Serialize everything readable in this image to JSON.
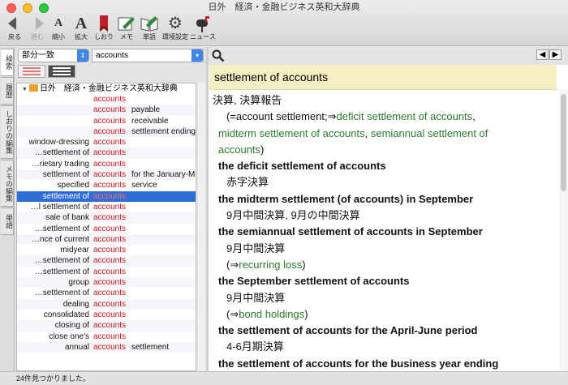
{
  "window": {
    "title": "日外　経済・金融ビジネス英和大辞典",
    "lights": [
      "#ff5f57",
      "#febc2e",
      "#28c840"
    ]
  },
  "toolbar": {
    "back": "戻る",
    "forward": "進む",
    "shrink": "縮小",
    "enlarge": "拡大",
    "bookmark": "しおり",
    "memo": "メモ",
    "wordbook": "単語",
    "settings": "環境設定",
    "news": "ニュース"
  },
  "tabs": {
    "search": "検索",
    "history": "履歴",
    "bookmark_edit": "しおりの編集",
    "memo_edit": "メモの編集",
    "wordbook": "単語"
  },
  "search": {
    "mode": "部分一致",
    "query": "accounts"
  },
  "list": {
    "dictionary": "日外　経済・金融ビジネス英和大辞典",
    "rows": [
      {
        "pre": "",
        "kw": "accounts",
        "post": ""
      },
      {
        "pre": "",
        "kw": "accounts",
        "post": "payable"
      },
      {
        "pre": "",
        "kw": "accounts",
        "post": "receivable"
      },
      {
        "pre": "",
        "kw": "accounts",
        "post": "settlement ending…"
      },
      {
        "pre": "window-dressing",
        "kw": "accounts",
        "post": ""
      },
      {
        "pre": "…settlement of",
        "kw": "accounts",
        "post": ""
      },
      {
        "pre": "…rietary trading",
        "kw": "accounts",
        "post": ""
      },
      {
        "pre": "settlement of",
        "kw": "accounts",
        "post": "for the January-M…"
      },
      {
        "pre": "specified",
        "kw": "accounts",
        "post": "service"
      },
      {
        "pre": "settlement of",
        "kw": "accounts",
        "post": "",
        "selected": true
      },
      {
        "pre": "…l settlement of",
        "kw": "accounts",
        "post": ""
      },
      {
        "pre": "sale of bank",
        "kw": "accounts",
        "post": ""
      },
      {
        "pre": "…settlement of",
        "kw": "accounts",
        "post": ""
      },
      {
        "pre": "…nce of current",
        "kw": "accounts",
        "post": ""
      },
      {
        "pre": "midyear",
        "kw": "accounts",
        "post": ""
      },
      {
        "pre": "…settlement of",
        "kw": "accounts",
        "post": ""
      },
      {
        "pre": "…settlement of",
        "kw": "accounts",
        "post": ""
      },
      {
        "pre": "group",
        "kw": "accounts",
        "post": ""
      },
      {
        "pre": "…settlement of",
        "kw": "accounts",
        "post": ""
      },
      {
        "pre": "dealing",
        "kw": "accounts",
        "post": ""
      },
      {
        "pre": "consolidated",
        "kw": "accounts",
        "post": ""
      },
      {
        "pre": "closing of",
        "kw": "accounts",
        "post": ""
      },
      {
        "pre": "close one's",
        "kw": "accounts",
        "post": ""
      },
      {
        "pre": "annual",
        "kw": "accounts",
        "post": "settlement"
      }
    ]
  },
  "entry": {
    "headword": "settlement of accounts",
    "translation": "決算, 決算報告",
    "equals": "(=account settlement;⇒",
    "links1": [
      "deficit settlement of accounts",
      "midterm settlement of accounts",
      "semiannual settlement of accounts"
    ],
    "sep": ", ",
    "close": ")",
    "sub1": "the deficit settlement of accounts",
    "sub1_ja": "赤字決算",
    "sub2": "the midterm settlement (of accounts) in September",
    "sub2_ja": "9月中間決算, 9月の中間決算",
    "sub3": "the semiannual settlement of accounts in September",
    "sub3_ja": "9月中間決算",
    "sub3_ref_open": "(⇒",
    "sub3_ref": "recurring loss",
    "sub3_ref_close": ")",
    "sub4": "the September settlement of accounts",
    "sub4_ja": "9月中間決算",
    "sub4_ref_open": "(⇒",
    "sub4_ref": "bond holdings",
    "sub4_ref_close": ")",
    "sub5": "the settlement of accounts for the April-June period",
    "sub5_ja": "4-6月期決算",
    "sub6": "the settlement of accounts for the business year ending"
  },
  "status": "24件見つかりました。"
}
